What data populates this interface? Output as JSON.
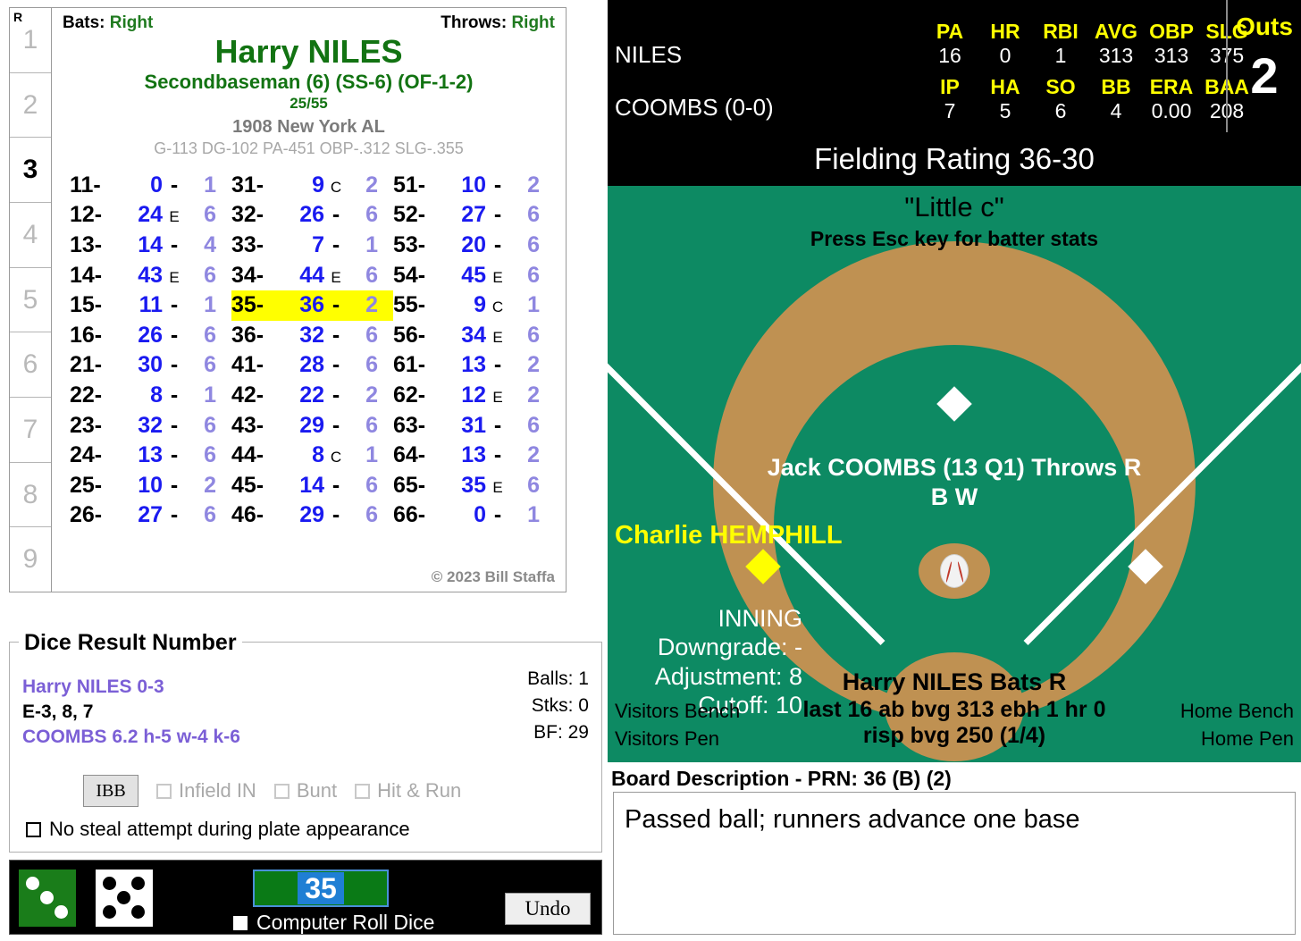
{
  "innings": {
    "header": "R",
    "list": [
      "1",
      "2",
      "3",
      "4",
      "5",
      "6",
      "7",
      "8",
      "9"
    ],
    "active": "3"
  },
  "player_card": {
    "bats_label": "Bats:",
    "bats_value": "Right",
    "throws_label": "Throws:",
    "throws_value": "Right",
    "name": "Harry NILES",
    "position": "Secondbaseman (6) (SS-6) (OF-1-2)",
    "fraction": "25/55",
    "team": "1908 New York AL",
    "stat_line": "G-113 DG-102 PA-451 OBP-.312 SLG-.355",
    "copyright": "© 2023 Bill Staffa",
    "dice_columns": [
      [
        {
          "code": "11-",
          "res": "0",
          "sep": "-",
          "tail": "1"
        },
        {
          "code": "12-",
          "res": "24",
          "sep": "E",
          "tail": "6"
        },
        {
          "code": "13-",
          "res": "14",
          "sep": "-",
          "tail": "4"
        },
        {
          "code": "14-",
          "res": "43",
          "sep": "E",
          "tail": "6"
        },
        {
          "code": "15-",
          "res": "11",
          "sep": "-",
          "tail": "1"
        },
        {
          "code": "16-",
          "res": "26",
          "sep": "-",
          "tail": "6"
        },
        {
          "code": "21-",
          "res": "30",
          "sep": "-",
          "tail": "6"
        },
        {
          "code": "22-",
          "res": "8",
          "sep": "-",
          "tail": "1"
        },
        {
          "code": "23-",
          "res": "32",
          "sep": "-",
          "tail": "6"
        },
        {
          "code": "24-",
          "res": "13",
          "sep": "-",
          "tail": "6"
        },
        {
          "code": "25-",
          "res": "10",
          "sep": "-",
          "tail": "2"
        },
        {
          "code": "26-",
          "res": "27",
          "sep": "-",
          "tail": "6"
        }
      ],
      [
        {
          "code": "31-",
          "res": "9",
          "sep": "C",
          "tail": "2"
        },
        {
          "code": "32-",
          "res": "26",
          "sep": "-",
          "tail": "6"
        },
        {
          "code": "33-",
          "res": "7",
          "sep": "-",
          "tail": "1"
        },
        {
          "code": "34-",
          "res": "44",
          "sep": "E",
          "tail": "6"
        },
        {
          "code": "35-",
          "res": "36",
          "sep": "-",
          "tail": "2",
          "highlight": true
        },
        {
          "code": "36-",
          "res": "32",
          "sep": "-",
          "tail": "6"
        },
        {
          "code": "41-",
          "res": "28",
          "sep": "-",
          "tail": "6"
        },
        {
          "code": "42-",
          "res": "22",
          "sep": "-",
          "tail": "2"
        },
        {
          "code": "43-",
          "res": "29",
          "sep": "-",
          "tail": "6"
        },
        {
          "code": "44-",
          "res": "8",
          "sep": "C",
          "tail": "1"
        },
        {
          "code": "45-",
          "res": "14",
          "sep": "-",
          "tail": "6"
        },
        {
          "code": "46-",
          "res": "29",
          "sep": "-",
          "tail": "6"
        }
      ],
      [
        {
          "code": "51-",
          "res": "10",
          "sep": "-",
          "tail": "2"
        },
        {
          "code": "52-",
          "res": "27",
          "sep": "-",
          "tail": "6"
        },
        {
          "code": "53-",
          "res": "20",
          "sep": "-",
          "tail": "6"
        },
        {
          "code": "54-",
          "res": "45",
          "sep": "E",
          "tail": "6"
        },
        {
          "code": "55-",
          "res": "9",
          "sep": "C",
          "tail": "1"
        },
        {
          "code": "56-",
          "res": "34",
          "sep": "E",
          "tail": "6"
        },
        {
          "code": "61-",
          "res": "13",
          "sep": "-",
          "tail": "2"
        },
        {
          "code": "62-",
          "res": "12",
          "sep": "E",
          "tail": "2"
        },
        {
          "code": "63-",
          "res": "31",
          "sep": "-",
          "tail": "6"
        },
        {
          "code": "64-",
          "res": "13",
          "sep": "-",
          "tail": "2"
        },
        {
          "code": "65-",
          "res": "35",
          "sep": "E",
          "tail": "6"
        },
        {
          "code": "66-",
          "res": "0",
          "sep": "-",
          "tail": "1"
        }
      ]
    ]
  },
  "dice_result": {
    "title": "Dice Result Number",
    "line1": "Harry NILES  0-3",
    "line2": "E-3, 8, 7",
    "line3": "COOMBS  6.2  h-5  w-4  k-6",
    "balls": "Balls: 1",
    "strikes": "Stks: 0",
    "bf": "BF: 29",
    "ibb_label": "IBB",
    "checkboxes": [
      {
        "label": "Infield IN",
        "checked": false,
        "enabled": false
      },
      {
        "label": "Bunt",
        "checked": false,
        "enabled": false
      },
      {
        "label": "Hit & Run",
        "checked": false,
        "enabled": false
      }
    ],
    "no_steal_label": "No steal attempt during plate appearance",
    "no_steal_checked": false
  },
  "dice_bar": {
    "green_die": 3,
    "white_die": 5,
    "roll_value": "35",
    "computer_roll_label": "Computer Roll Dice",
    "computer_roll_checked": false,
    "undo_label": "Undo"
  },
  "scorebar": {
    "batter_name": "NILES",
    "batter_headers": [
      "PA",
      "HR",
      "RBI",
      "AVG",
      "OBP",
      "SLG"
    ],
    "batter_values": [
      "16",
      "0",
      "1",
      "313",
      "313",
      "375"
    ],
    "pitcher_name": "COOMBS (0-0)",
    "pitcher_headers": [
      "IP",
      "HA",
      "SO",
      "BB",
      "ERA",
      "BAA"
    ],
    "pitcher_values": [
      "7",
      "5",
      "6",
      "4",
      "0.00",
      "208"
    ],
    "outs_label": "Outs",
    "outs_value": "2"
  },
  "field": {
    "fielding_rating": "Fielding Rating 36-30",
    "little_c": "\"Little c\"",
    "esc_hint": "Press Esc key for batter stats",
    "pitcher_line": "Jack COOMBS (13 Q1) Throws R",
    "pitcher_line2": "B W",
    "runner_third": "Charlie HEMPHILL",
    "inning_label": "INNING",
    "downgrade": "Downgrade: -",
    "adjustment": "Adjustment: 8",
    "cutoff": "Cutoff: 10",
    "batter_name_line": "Harry NILES Bats R",
    "batter_sub1": "last 16 ab bvg 313 ebh 1 hr 0",
    "batter_sub2": "risp bvg 250 (1/4)",
    "visitors_bench": "Visitors Bench",
    "visitors_pen": "Visitors Pen",
    "home_bench": "Home Bench",
    "home_pen": "Home Pen"
  },
  "board": {
    "title": "Board Description - PRN: 36 (B) (2)",
    "description": "Passed ball; runners advance one base"
  }
}
